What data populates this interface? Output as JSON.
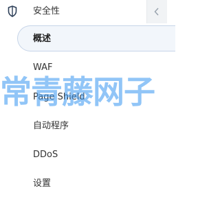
{
  "section": {
    "title": "安全性",
    "icon": "shield-icon"
  },
  "menu": {
    "items": [
      {
        "label": "概述",
        "active": true
      },
      {
        "label": "WAF",
        "active": false
      },
      {
        "label": "Page Shield",
        "active": false
      },
      {
        "label": "自动程序",
        "active": false
      },
      {
        "label": "DDoS",
        "active": false
      },
      {
        "label": "设置",
        "active": false
      }
    ]
  },
  "watermark": "常青藤网子",
  "colors": {
    "active_border": "#c6d4e8",
    "active_bg": "#f2f6fb",
    "text": "#333333",
    "watermark": "#3796f0"
  }
}
